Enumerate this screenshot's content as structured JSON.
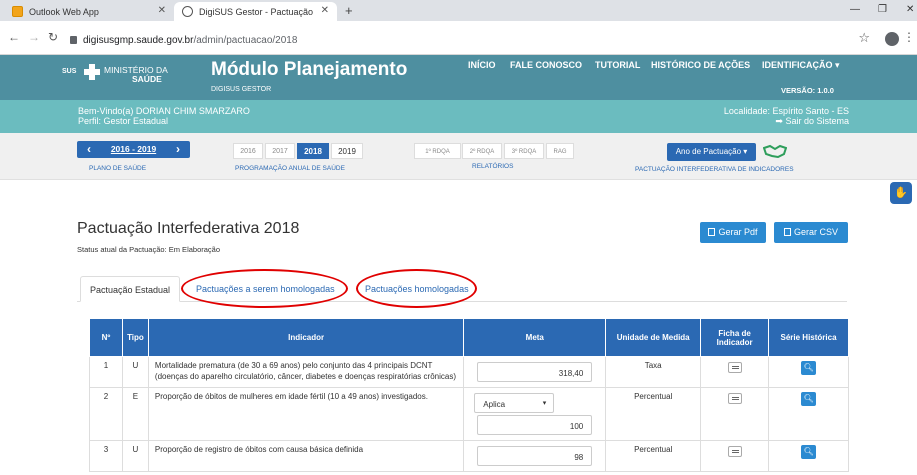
{
  "browser": {
    "tabs": [
      {
        "label": "Outlook Web App",
        "icon": "outlook-icon"
      },
      {
        "label": "DigiSUS Gestor - Pactuação",
        "icon": "globe-icon"
      }
    ],
    "url_host": "digisusgmp.saude.gov.br",
    "url_path": "/admin/pactuacao/2018"
  },
  "header": {
    "logo_sus": "SUS",
    "logo_ministerio": "MINISTÉRIO DA",
    "logo_saude": "SAÚDE",
    "title": "Módulo Planejamento",
    "subtitle": "DIGISUS GESTOR",
    "nav": [
      "INÍCIO",
      "FALE CONOSCO",
      "TUTORIAL",
      "HISTÓRICO DE AÇÕES",
      "IDENTIFICAÇÃO ▾"
    ],
    "versao": "VERSÃO: 1.0.0"
  },
  "welcome": {
    "line1": "Bem-Vindo(a) DORIAN CHIM SMARZARO",
    "line2": "Perfil: Gestor Estadual",
    "localidade": "Localidade: Espírito Santo - ES",
    "sair": "➡ Sair do Sistema"
  },
  "toolbar": {
    "plano_range": "2016 - 2019",
    "plano_label": "PLANO DE SAÚDE",
    "years": [
      "2016",
      "2017",
      "2018",
      "2019"
    ],
    "selected_year": "2018",
    "programacao_label": "PROGRAMAÇÃO ANUAL DE SAÚDE",
    "relatorios": [
      "1º RDQA",
      "2º RDQA",
      "3º RDQA",
      "RAG"
    ],
    "relatorios_label": "RELATÓRIOS",
    "ano_pactuacao": "Ano de Pactuação ▾",
    "pactuacao_label": "PACTUAÇÃO INTERFEDERATIVA DE INDICADORES"
  },
  "main": {
    "title": "Pactuação Interfederativa 2018",
    "status": "Status atual da Pactuação: Em Elaboração",
    "btn_pdf": "Gerar Pdf",
    "btn_csv": "Gerar CSV",
    "tabs": [
      "Pactuação Estadual",
      "Pactuações a serem homologadas",
      "Pactuações homologadas"
    ]
  },
  "table": {
    "headers": [
      "Nº",
      "Tipo",
      "Indicador",
      "Meta",
      "Unidade de Medida",
      "Ficha de Indicador",
      "Série Histórica"
    ],
    "rows": [
      {
        "n": "1",
        "tipo": "U",
        "indicador": "Mortalidade prematura (de 30 a 69 anos) pelo conjunto das 4 principais DCNT (doenças do aparelho circulatório, câncer, diabetes e doenças respiratórias crônicas)",
        "meta": "318,40",
        "unidade": "Taxa"
      },
      {
        "n": "2",
        "tipo": "E",
        "indicador": "Proporção de óbitos de mulheres em idade fértil (10 a 49 anos) investigados.",
        "meta_select": "Aplica",
        "meta": "100",
        "unidade": "Percentual"
      },
      {
        "n": "3",
        "tipo": "U",
        "indicador": "Proporção de registro de óbitos com causa básica definida",
        "meta": "98",
        "unidade": "Percentual"
      }
    ]
  }
}
